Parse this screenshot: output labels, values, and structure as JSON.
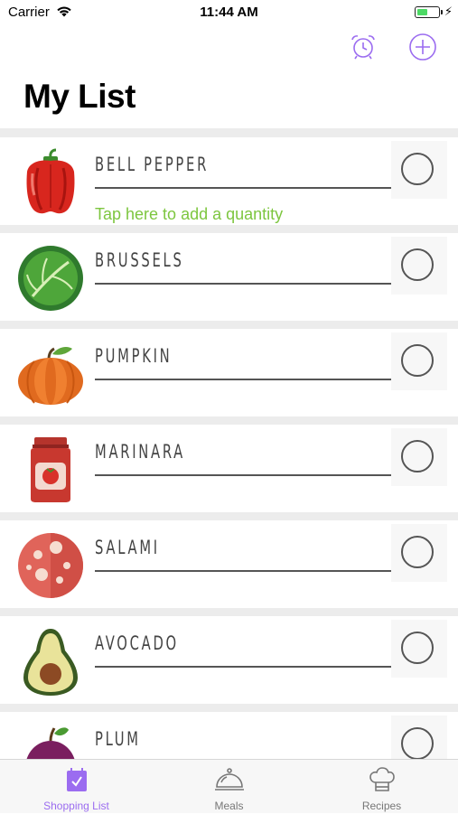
{
  "status_bar": {
    "carrier": "Carrier",
    "time": "11:44 AM"
  },
  "nav": {
    "title": "My List",
    "alarm_icon": "alarm-clock-icon",
    "add_icon": "plus-circle-icon"
  },
  "colors": {
    "accent": "#9b6cf0",
    "quantity_hint": "#7dc63f",
    "separator": "#ececec"
  },
  "items": [
    {
      "name": "BELL PEPPER",
      "icon": "bell-pepper-icon",
      "quantity_hint": "Tap here to add a quantity"
    },
    {
      "name": "BRUSSELS",
      "icon": "brussels-sprout-icon"
    },
    {
      "name": "PUMPKIN",
      "icon": "pumpkin-icon"
    },
    {
      "name": "MARINARA",
      "icon": "marinara-jar-icon"
    },
    {
      "name": "SALAMI",
      "icon": "salami-icon"
    },
    {
      "name": "AVOCADO",
      "icon": "avocado-icon"
    },
    {
      "name": "PLUM",
      "icon": "plum-icon"
    }
  ],
  "tabs": [
    {
      "label": "Shopping List",
      "icon": "calendar-check-icon",
      "active": true
    },
    {
      "label": "Meals",
      "icon": "cloche-icon"
    },
    {
      "label": "Recipes",
      "icon": "chef-hat-icon"
    }
  ]
}
